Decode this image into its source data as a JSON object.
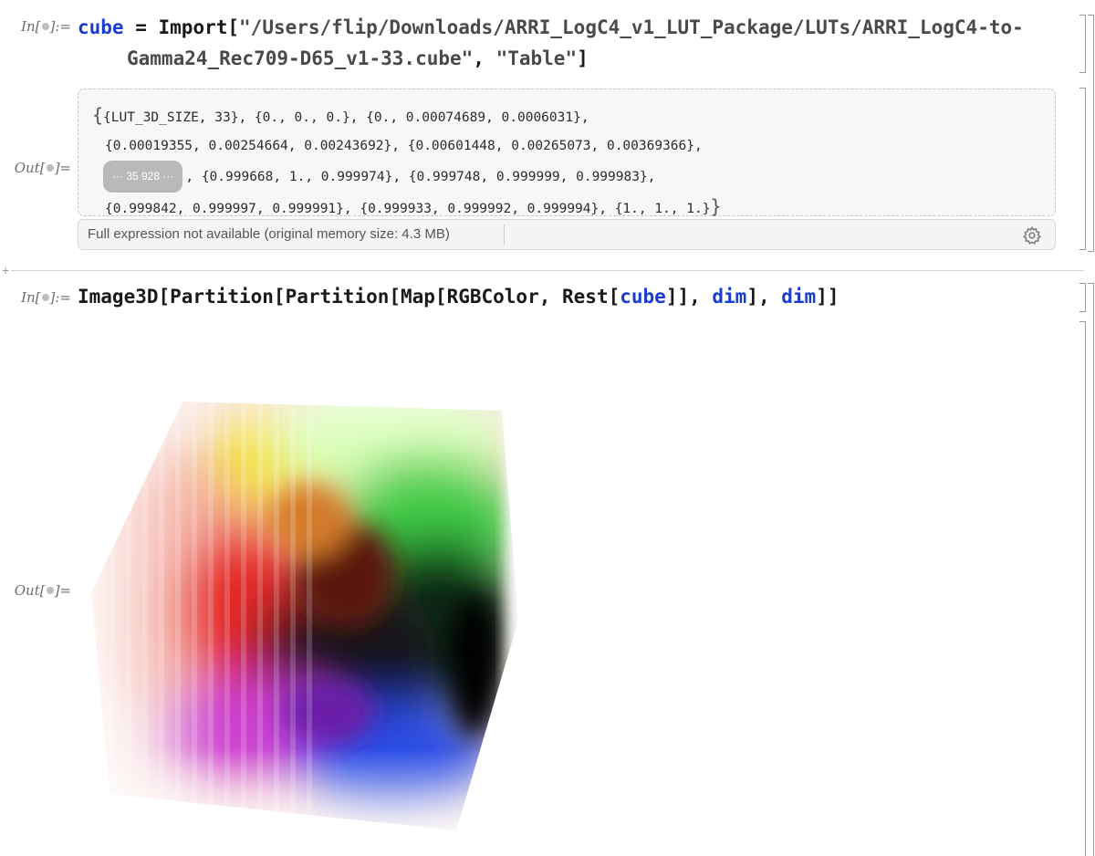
{
  "cells": {
    "in1": {
      "label_prefix": "In[",
      "label_suffix": "]:=",
      "line1": {
        "var": "cube",
        "assign": " = ",
        "func": "Import[",
        "path_part1": "\"/Users/flip/Downloads/ARRI_LogC4_v1_LUT_Package/LUTs/ARRI_LogC4-to-"
      },
      "line2": {
        "path_part2": "Gamma24_Rec709-D65_v1-33.cube\"",
        "comma": ", ",
        "format": "\"Table\"",
        "close": "]"
      }
    },
    "out1": {
      "label_prefix": "Out[",
      "label_suffix": "]=",
      "line1_open": "{",
      "line1": "{LUT_3D_SIZE, 33}, {0., 0., 0.}, {0., 0.00074689, 0.0006031},",
      "line2": "{0.00019355, 0.00254664, 0.00243692}, {0.00601448, 0.00265073, 0.00369366},",
      "elided_count": "··· 35 928 ···",
      "line3": ", {0.999668, 1., 0.999974}, {0.999748, 0.999999, 0.999983},",
      "line4": "{0.999842, 0.999997, 0.999991}, {0.999933, 0.999992, 0.999994}, {1., 1., 1.}",
      "line4_close": "}",
      "status_text": "Full expression not available (original memory size: 4.3 MB)"
    },
    "in2": {
      "label_prefix": "In[",
      "label_suffix": "]:=",
      "code": {
        "part1": "Image3D[Partition[Partition[Map[RGBColor, Rest[",
        "cube": "cube",
        "part2": "]], ",
        "dim1": "dim",
        "part3": "], ",
        "dim2": "dim",
        "part4": "]]"
      }
    },
    "out2": {
      "label_prefix": "Out[",
      "label_suffix": "]="
    }
  },
  "colors": {
    "symbol_blue": "#1a3ccf",
    "label_gray": "#6d6d6d"
  },
  "icons": {
    "settings": "gear-icon",
    "insert": "plus-icon"
  }
}
